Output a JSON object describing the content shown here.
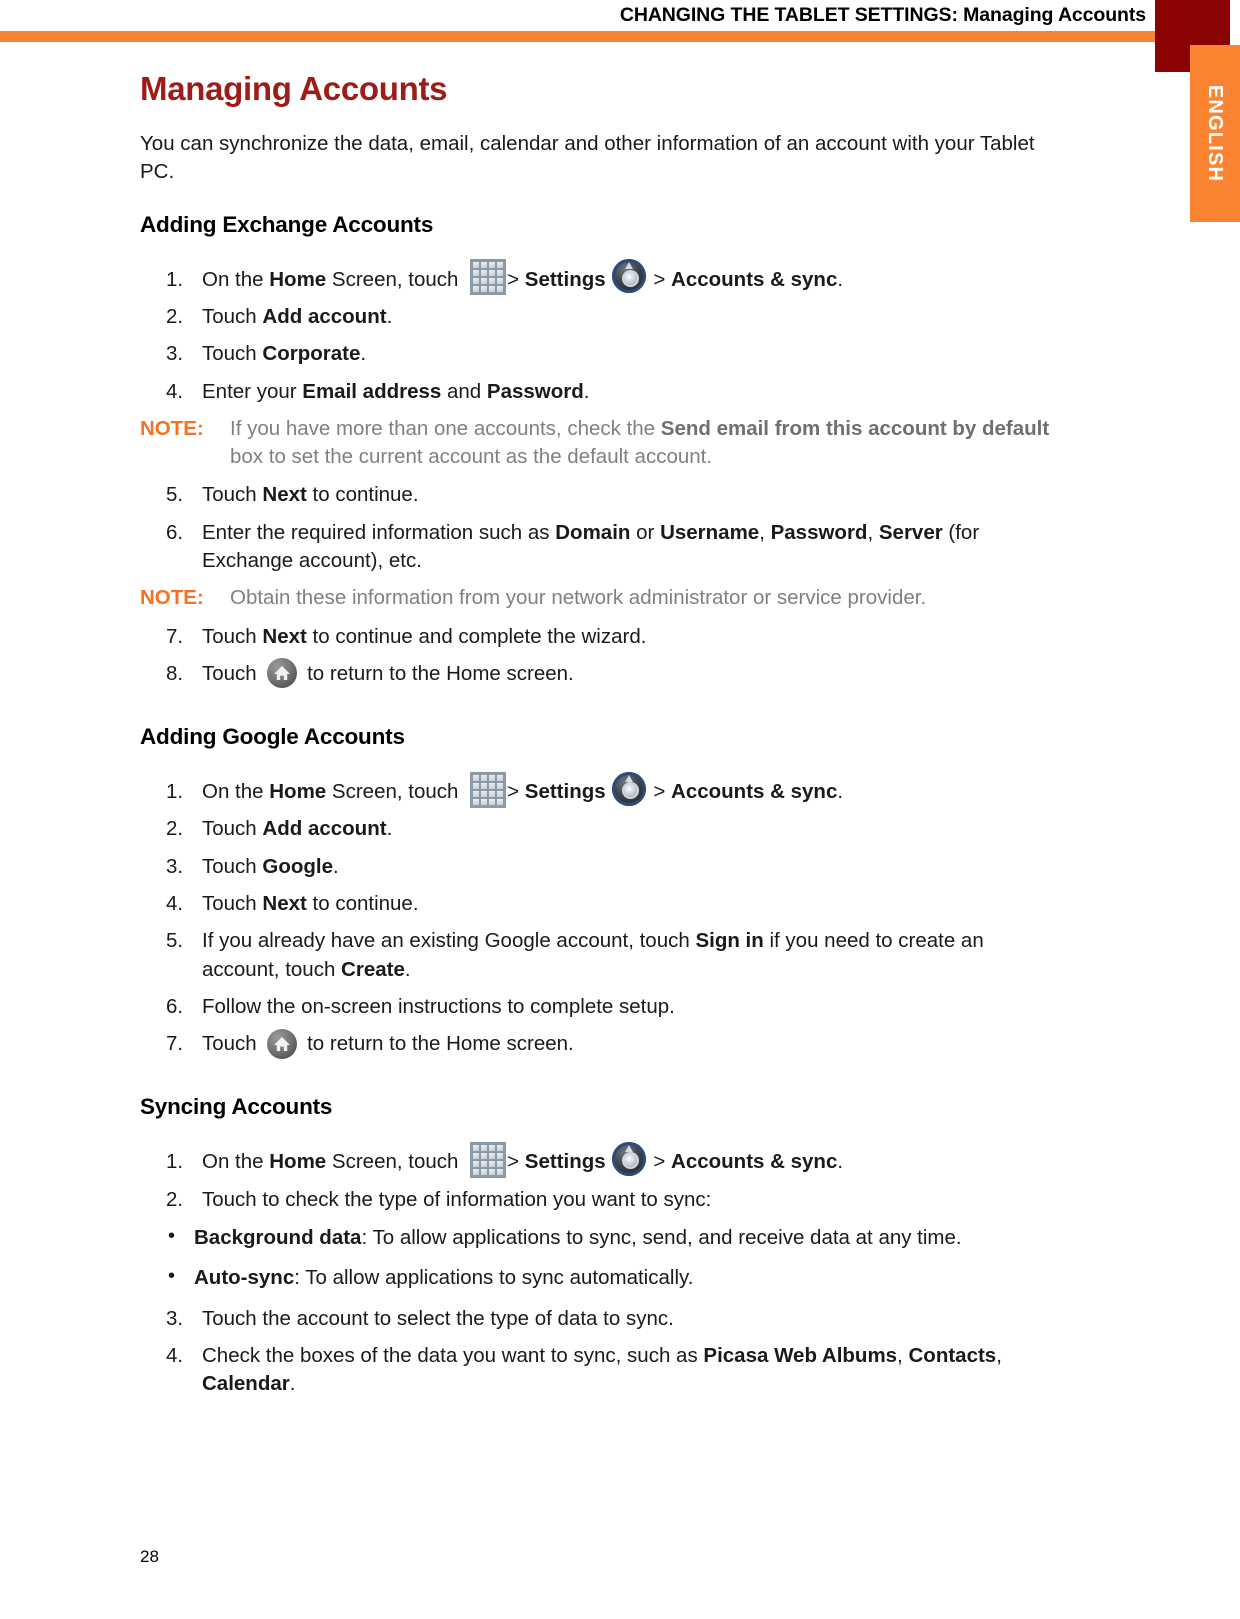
{
  "header": {
    "title": "CHANGING THE TABLET SETTINGS: Managing Accounts",
    "accent_color": "#fb8432",
    "corner_color": "#8b0404"
  },
  "language_tab": {
    "label": "ENGLISH"
  },
  "page": {
    "title": "Managing Accounts",
    "title_color": "#9d1c17",
    "intro": "You can synchronize the data, email, calendar and other information of an account with your Tablet PC.",
    "page_number": "28"
  },
  "sections": [
    {
      "heading": "Adding Exchange Accounts",
      "steps": [
        {
          "num": "1.",
          "parts": [
            {
              "t": "On the ",
              "b": false
            },
            {
              "t": "Home",
              "b": true
            },
            {
              "t": " Screen, touch ",
              "b": false
            },
            {
              "icon": "apps-grid-icon"
            },
            {
              "t": "> ",
              "b": false
            },
            {
              "t": "Settings",
              "b": true
            },
            {
              "icon": "settings-gauge-icon"
            },
            {
              "t": " > ",
              "b": false
            },
            {
              "t": "Accounts & sync",
              "b": true
            },
            {
              "t": ".",
              "b": false
            }
          ]
        },
        {
          "num": "2.",
          "parts": [
            {
              "t": "Touch ",
              "b": false
            },
            {
              "t": "Add account",
              "b": true
            },
            {
              "t": ".",
              "b": false
            }
          ]
        },
        {
          "num": "3.",
          "parts": [
            {
              "t": "Touch ",
              "b": false
            },
            {
              "t": "Corporate",
              "b": true
            },
            {
              "t": ".",
              "b": false
            }
          ]
        },
        {
          "num": "4.",
          "parts": [
            {
              "t": "Enter your ",
              "b": false
            },
            {
              "t": "Email address",
              "b": true
            },
            {
              "t": " and ",
              "b": false
            },
            {
              "t": "Password",
              "b": true
            },
            {
              "t": ".",
              "b": false
            }
          ]
        }
      ],
      "note_after_step4": {
        "label": "NOTE:",
        "parts": [
          {
            "t": "If you have more than one accounts, check the ",
            "b": false
          },
          {
            "t": "Send email from this account by default",
            "b": true
          },
          {
            "t": " box to set the current account as the default account.",
            "b": false
          }
        ]
      },
      "steps_2": [
        {
          "num": "5.",
          "parts": [
            {
              "t": "Touch ",
              "b": false
            },
            {
              "t": "Next",
              "b": true
            },
            {
              "t": " to continue.",
              "b": false
            }
          ]
        },
        {
          "num": "6.",
          "parts": [
            {
              "t": "Enter the required information such as ",
              "b": false
            },
            {
              "t": "Domain",
              "b": true
            },
            {
              "t": " or ",
              "b": false
            },
            {
              "t": "Username",
              "b": true
            },
            {
              "t": ", ",
              "b": false
            },
            {
              "t": "Password",
              "b": true
            },
            {
              "t": ", ",
              "b": false
            },
            {
              "t": "Server",
              "b": true
            },
            {
              "t": " (for Exchange account), etc.",
              "b": false
            }
          ]
        }
      ],
      "note_after_step6": {
        "label": "NOTE:",
        "parts": [
          {
            "t": "Obtain these information from your network administrator or service provider.",
            "b": false
          }
        ]
      },
      "steps_3": [
        {
          "num": "7.",
          "parts": [
            {
              "t": "Touch ",
              "b": false
            },
            {
              "t": "Next",
              "b": true
            },
            {
              "t": " to continue and complete the wizard.",
              "b": false
            }
          ]
        },
        {
          "num": "8.",
          "parts": [
            {
              "t": "Touch ",
              "b": false
            },
            {
              "icon": "home-icon"
            },
            {
              "t": " to return to the Home screen.",
              "b": false
            }
          ]
        }
      ]
    },
    {
      "heading": "Adding Google Accounts",
      "steps": [
        {
          "num": "1.",
          "parts": [
            {
              "t": "On the ",
              "b": false
            },
            {
              "t": "Home",
              "b": true
            },
            {
              "t": " Screen, touch ",
              "b": false
            },
            {
              "icon": "apps-grid-icon"
            },
            {
              "t": "> ",
              "b": false
            },
            {
              "t": "Settings",
              "b": true
            },
            {
              "icon": "settings-gauge-icon"
            },
            {
              "t": " > ",
              "b": false
            },
            {
              "t": "Accounts & sync",
              "b": true
            },
            {
              "t": ".",
              "b": false
            }
          ]
        },
        {
          "num": "2.",
          "parts": [
            {
              "t": "Touch ",
              "b": false
            },
            {
              "t": "Add account",
              "b": true
            },
            {
              "t": ".",
              "b": false
            }
          ]
        },
        {
          "num": "3.",
          "parts": [
            {
              "t": "Touch ",
              "b": false
            },
            {
              "t": "Google",
              "b": true
            },
            {
              "t": ".",
              "b": false
            }
          ]
        },
        {
          "num": "4.",
          "parts": [
            {
              "t": "Touch ",
              "b": false
            },
            {
              "t": "Next",
              "b": true
            },
            {
              "t": " to continue.",
              "b": false
            }
          ]
        },
        {
          "num": "5.",
          "parts": [
            {
              "t": "If you already have an existing Google account, touch ",
              "b": false
            },
            {
              "t": "Sign in",
              "b": true
            },
            {
              "t": " if you need to create an account, touch ",
              "b": false
            },
            {
              "t": "Create",
              "b": true
            },
            {
              "t": ".",
              "b": false
            }
          ]
        },
        {
          "num": "6.",
          "parts": [
            {
              "t": "Follow the on-screen instructions to complete setup.",
              "b": false
            }
          ]
        },
        {
          "num": "7.",
          "parts": [
            {
              "t": "Touch ",
              "b": false
            },
            {
              "icon": "home-icon"
            },
            {
              "t": " to return to the Home screen.",
              "b": false
            }
          ]
        }
      ]
    },
    {
      "heading": "Syncing Accounts",
      "steps": [
        {
          "num": "1.",
          "parts": [
            {
              "t": "On the ",
              "b": false
            },
            {
              "t": "Home",
              "b": true
            },
            {
              "t": " Screen, touch ",
              "b": false
            },
            {
              "icon": "apps-grid-icon"
            },
            {
              "t": "> ",
              "b": false
            },
            {
              "t": "Settings",
              "b": true
            },
            {
              "icon": "settings-gauge-icon"
            },
            {
              "t": " > ",
              "b": false
            },
            {
              "t": "Accounts & sync",
              "b": true
            },
            {
              "t": ".",
              "b": false
            }
          ]
        },
        {
          "num": "2.",
          "parts": [
            {
              "t": "Touch to check the type of information you want to sync:",
              "b": false
            }
          ]
        }
      ],
      "bullets": [
        {
          "dot": "•",
          "parts": [
            {
              "t": "Background data",
              "b": true
            },
            {
              "t": ": To allow applications to sync, send, and receive data at any time.",
              "b": false
            }
          ]
        },
        {
          "dot": "•",
          "parts": [
            {
              "t": "Auto-sync",
              "b": true
            },
            {
              "t": ": To allow applications to sync automatically.",
              "b": false
            }
          ]
        }
      ],
      "steps_2": [
        {
          "num": "3.",
          "parts": [
            {
              "t": "Touch the account to select the type of data to sync.",
              "b": false
            }
          ]
        },
        {
          "num": "4.",
          "parts": [
            {
              "t": "Check the boxes of the data you want to sync, such as ",
              "b": false
            },
            {
              "t": "Picasa Web Albums",
              "b": true
            },
            {
              "t": ", ",
              "b": false
            },
            {
              "t": "Contacts",
              "b": true
            },
            {
              "t": ", ",
              "b": false
            },
            {
              "t": "Calendar",
              "b": true
            },
            {
              "t": ".",
              "b": false
            }
          ]
        }
      ]
    }
  ]
}
